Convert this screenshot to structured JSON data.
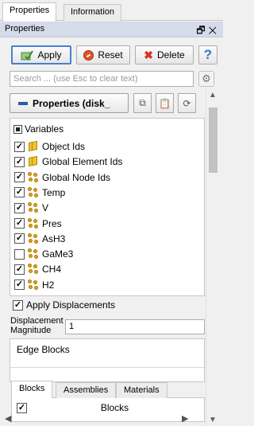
{
  "tabs": [
    {
      "label": "Properties",
      "active": true
    },
    {
      "label": "Information",
      "active": false
    }
  ],
  "panel": {
    "title": "Properties",
    "float_glyph": "🗗",
    "close_glyph": "✕"
  },
  "toolbar": {
    "apply_label": "Apply",
    "reset_label": "Reset",
    "delete_label": "Delete",
    "help_label": "?"
  },
  "search": {
    "placeholder": "Search ... (use Esc to clear text)"
  },
  "section": {
    "title": "Properties (disk_"
  },
  "variables": {
    "header": "Variables",
    "items": [
      {
        "label": "Object Ids",
        "checked": true,
        "kind": "cell"
      },
      {
        "label": "Global Element Ids",
        "checked": true,
        "kind": "cell"
      },
      {
        "label": "Global Node Ids",
        "checked": true,
        "kind": "point"
      },
      {
        "label": "Temp",
        "checked": true,
        "kind": "point"
      },
      {
        "label": "V",
        "checked": true,
        "kind": "point"
      },
      {
        "label": "Pres",
        "checked": true,
        "kind": "point"
      },
      {
        "label": "AsH3",
        "checked": true,
        "kind": "point"
      },
      {
        "label": "GaMe3",
        "checked": false,
        "kind": "point"
      },
      {
        "label": "CH4",
        "checked": true,
        "kind": "point"
      },
      {
        "label": "H2",
        "checked": true,
        "kind": "point"
      }
    ]
  },
  "apply_displacements": {
    "label": "Apply Displacements",
    "checked": true
  },
  "displacement_magnitude": {
    "label_line1": "Displacement",
    "label_line2": "Magnitude",
    "value": "1"
  },
  "edge_blocks": {
    "title": "Edge Blocks"
  },
  "block_tabs": [
    {
      "label": "Blocks",
      "active": true
    },
    {
      "label": "Assemblies",
      "active": false
    },
    {
      "label": "Materials",
      "active": false
    }
  ],
  "blocks_table": {
    "header": "Blocks",
    "checked": true
  },
  "colors": {
    "accent": "#4a7fd0",
    "panel_title_bg": "#d6dbe9",
    "cell_icon": "#f0c330",
    "point_icon": "#e0a21c"
  }
}
